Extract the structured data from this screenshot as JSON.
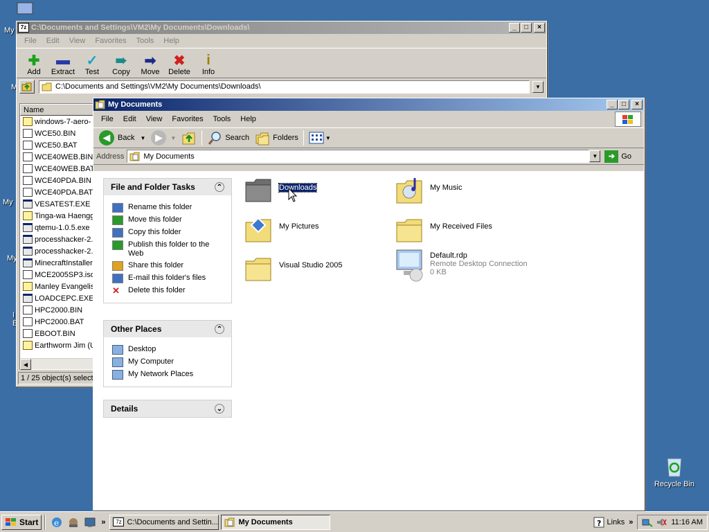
{
  "desktop": {
    "fragments": {
      "my_top": "My",
      "m1": "M",
      "my_mid": "My",
      "my_low": "My",
      "i": "I",
      "e": "E"
    },
    "recycle_bin": "Recycle Bin"
  },
  "zip_window": {
    "title": "C:\\Documents and Settings\\VM2\\My Documents\\Downloads\\",
    "menu": [
      "File",
      "Edit",
      "View",
      "Favorites",
      "Tools",
      "Help"
    ],
    "toolbar": [
      {
        "label": "Add",
        "icon": "plus-icon",
        "color": "#1aa31a"
      },
      {
        "label": "Extract",
        "icon": "minus-icon",
        "color": "#2a3aa8"
      },
      {
        "label": "Test",
        "icon": "check-icon",
        "color": "#1aa3c8"
      },
      {
        "label": "Copy",
        "icon": "double-arrow-icon",
        "color": "#1a8a8a"
      },
      {
        "label": "Move",
        "icon": "arrow-right-icon",
        "color": "#1a2a8a"
      },
      {
        "label": "Delete",
        "icon": "x-icon",
        "color": "#d02020"
      },
      {
        "label": "Info",
        "icon": "info-icon",
        "color": "#a08000"
      }
    ],
    "path": "C:\\Documents and Settings\\VM2\\My Documents\\Downloads\\",
    "column_name": "Name",
    "files": [
      {
        "name": "windows-7-aero-",
        "type": "zip"
      },
      {
        "name": "WCE50.BIN",
        "type": "bin"
      },
      {
        "name": "WCE50.BAT",
        "type": "bin"
      },
      {
        "name": "WCE40WEB.BIN",
        "type": "bin"
      },
      {
        "name": "WCE40WEB.BAT",
        "type": "bin"
      },
      {
        "name": "WCE40PDA.BIN",
        "type": "bin"
      },
      {
        "name": "WCE40PDA.BAT",
        "type": "bin"
      },
      {
        "name": "VESATEST.EXE",
        "type": "exe"
      },
      {
        "name": "Tinga-wa Haengg",
        "type": "zip"
      },
      {
        "name": "qtemu-1.0.5.exe",
        "type": "exe"
      },
      {
        "name": "processhacker-2.",
        "type": "exe"
      },
      {
        "name": "processhacker-2.",
        "type": "exe"
      },
      {
        "name": "MinecraftInstaller",
        "type": "exe"
      },
      {
        "name": "MCE2005SP3.iso",
        "type": "bin"
      },
      {
        "name": "Manley Evangelis",
        "type": "zip"
      },
      {
        "name": "LOADCEPC.EXE",
        "type": "exe"
      },
      {
        "name": "HPC2000.BIN",
        "type": "bin"
      },
      {
        "name": "HPC2000.BAT",
        "type": "bin"
      },
      {
        "name": "EBOOT.BIN",
        "type": "bin"
      },
      {
        "name": "Earthworm Jim (U",
        "type": "zip"
      }
    ],
    "status": "1 / 25 object(s) select"
  },
  "explorer": {
    "title": "My Documents",
    "menu": [
      "File",
      "Edit",
      "View",
      "Favorites",
      "Tools",
      "Help"
    ],
    "toolbar": {
      "back": "Back",
      "search": "Search",
      "folders": "Folders"
    },
    "address_label": "Address",
    "address_value": "My Documents",
    "go": "Go",
    "tasks": {
      "title": "File and Folder Tasks",
      "items": [
        "Rename this folder",
        "Move this folder",
        "Copy this folder",
        "Publish this folder to the Web",
        "Share this folder",
        "E-mail this folder's files",
        "Delete this folder"
      ]
    },
    "other_places": {
      "title": "Other Places",
      "items": [
        "Desktop",
        "My Computer",
        "My Network Places"
      ]
    },
    "details": {
      "title": "Details"
    },
    "folders": [
      {
        "name": "Downloads",
        "selected": true,
        "icon": "folder-dark-icon"
      },
      {
        "name": "My Music",
        "icon": "music-folder-icon"
      },
      {
        "name": "My Pictures",
        "icon": "pictures-folder-icon"
      },
      {
        "name": "My Received Files",
        "icon": "folder-icon"
      },
      {
        "name": "Visual Studio 2005",
        "icon": "folder-icon"
      },
      {
        "name": "Default.rdp",
        "sub1": "Remote Desktop Connection",
        "sub2": "0 KB",
        "icon": "remote-desktop-icon"
      }
    ]
  },
  "taskbar": {
    "start": "Start",
    "chevron": "»",
    "tasks": [
      {
        "label": "C:\\Documents and Settin...",
        "pressed": false
      },
      {
        "label": "My Documents",
        "pressed": true
      }
    ],
    "links": "Links",
    "links_chevron": "»",
    "clock": "11:16 AM"
  }
}
